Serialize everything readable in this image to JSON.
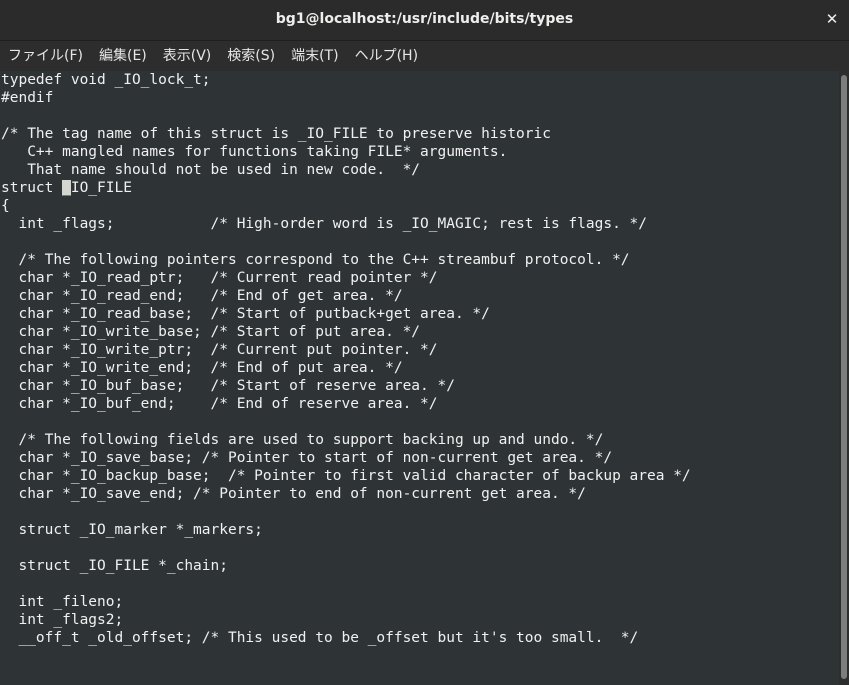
{
  "window": {
    "title": "bg1@localhost:/usr/include/bits/types",
    "close_label": "✕"
  },
  "menu": {
    "items": [
      {
        "label": "ファイル(F)"
      },
      {
        "label": "編集(E)"
      },
      {
        "label": "表示(V)"
      },
      {
        "label": "検索(S)"
      },
      {
        "label": "端末(T)"
      },
      {
        "label": "ヘルプ(H)"
      }
    ]
  },
  "terminal": {
    "lines": [
      "typedef void _IO_lock_t;",
      "#endif",
      "",
      "/* The tag name of this struct is _IO_FILE to preserve historic",
      "   C++ mangled names for functions taking FILE* arguments.",
      "   That name should not be used in new code.  */",
      "struct ",
      "{",
      "  int _flags;           /* High-order word is _IO_MAGIC; rest is flags. */",
      "",
      "  /* The following pointers correspond to the C++ streambuf protocol. */",
      "  char *_IO_read_ptr;   /* Current read pointer */",
      "  char *_IO_read_end;   /* End of get area. */",
      "  char *_IO_read_base;  /* Start of putback+get area. */",
      "  char *_IO_write_base; /* Start of put area. */",
      "  char *_IO_write_ptr;  /* Current put pointer. */",
      "  char *_IO_write_end;  /* End of put area. */",
      "  char *_IO_buf_base;   /* Start of reserve area. */",
      "  char *_IO_buf_end;    /* End of reserve area. */",
      "",
      "  /* The following fields are used to support backing up and undo. */",
      "  char *_IO_save_base; /* Pointer to start of non-current get area. */",
      "  char *_IO_backup_base;  /* Pointer to first valid character of backup area */",
      "  char *_IO_save_end; /* Pointer to end of non-current get area. */",
      "",
      "  struct _IO_marker *_markers;",
      "",
      "  struct _IO_FILE *_chain;",
      "",
      "  int _fileno;",
      "  int _flags2;",
      "  __off_t _old_offset; /* This used to be _offset but it's too small.  */"
    ],
    "cursor_line": {
      "prefix": "struct ",
      "cursor_char": "_",
      "suffix": "IO_FILE"
    }
  }
}
